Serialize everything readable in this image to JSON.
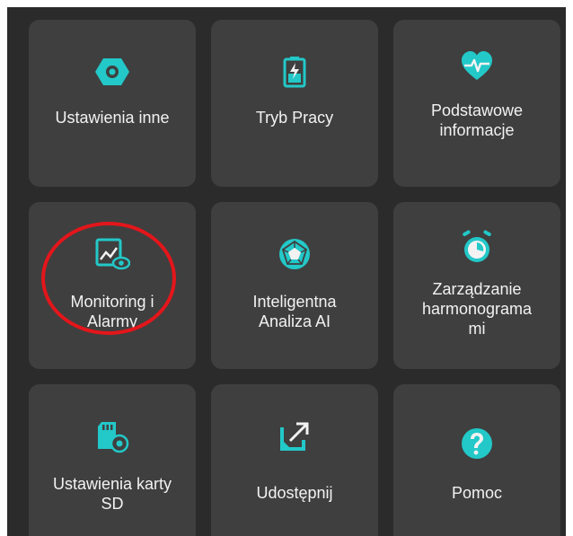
{
  "colors": {
    "background": "#2b2b2b",
    "tile": "#3f3f3f",
    "accent": "#23c8c8",
    "text": "#f2f2f2",
    "annotation": "#e3161b"
  },
  "menu": {
    "items": [
      {
        "label": "Ustawienia inne",
        "icon": "gear-hexagon-icon"
      },
      {
        "label": "Tryb Pracy",
        "icon": "battery-mode-icon"
      },
      {
        "label": "Podstawowe\ninformacje",
        "icon": "heart-pulse-icon"
      },
      {
        "label": "Monitoring i\nAlarmy",
        "icon": "monitor-eye-icon"
      },
      {
        "label": "Inteligentna\nAnaliza AI",
        "icon": "ai-polygon-icon"
      },
      {
        "label": "Zarządzanie\nharmonograma\nmi",
        "icon": "alarm-clock-icon"
      },
      {
        "label": "Ustawienia karty\nSD",
        "icon": "sd-card-gear-icon"
      },
      {
        "label": "Udostępnij",
        "icon": "share-arrow-icon"
      },
      {
        "label": "Pomoc",
        "icon": "help-icon"
      }
    ]
  }
}
